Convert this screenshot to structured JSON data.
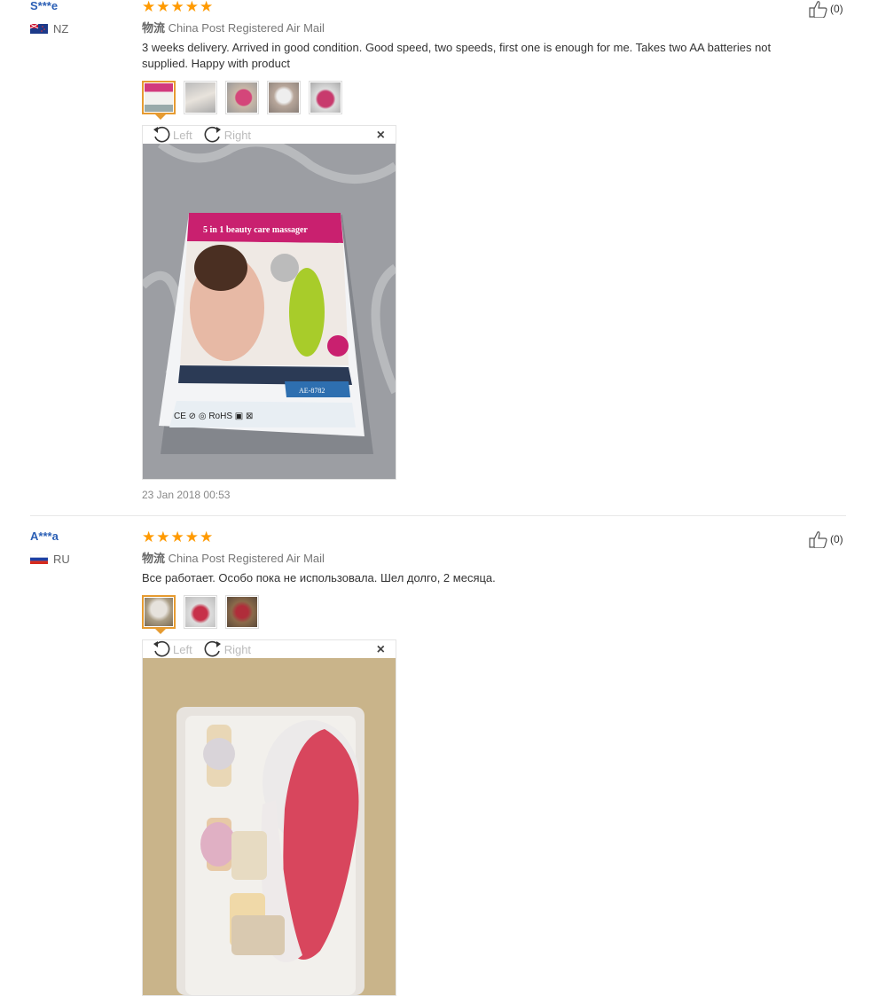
{
  "reviews": [
    {
      "user": "S***e",
      "country": "NZ",
      "rating": 5,
      "shipping_label": "物流",
      "shipping": "China Post Registered Air Mail",
      "text": "3 weeks delivery. Arrived in good condition. Good speed, two speeds, first one is enough for me. Takes two AA batteries not supplied. Happy with product",
      "helpful": "(0)",
      "thumbs_count": 5,
      "viewer": {
        "left_label": "Left",
        "right_label": "Right",
        "close": "×"
      },
      "date": "23 Jan 2018 00:53",
      "photo_box_title": "5 in 1 beauty care massager",
      "photo_box_model": "AE-8782"
    },
    {
      "user": "A***a",
      "country": "RU",
      "rating": 5,
      "shipping_label": "物流",
      "shipping": "China Post Registered Air Mail",
      "text": "Все работает. Особо пока не использовала. Шел долго, 2 месяца.",
      "helpful": "(0)",
      "thumbs_count": 3,
      "viewer": {
        "left_label": "Left",
        "right_label": "Right",
        "close": "×"
      }
    }
  ],
  "colors": {
    "accent": "#ff9a00",
    "user": "#2b5fb5",
    "active_thumb": "#e69b31"
  }
}
